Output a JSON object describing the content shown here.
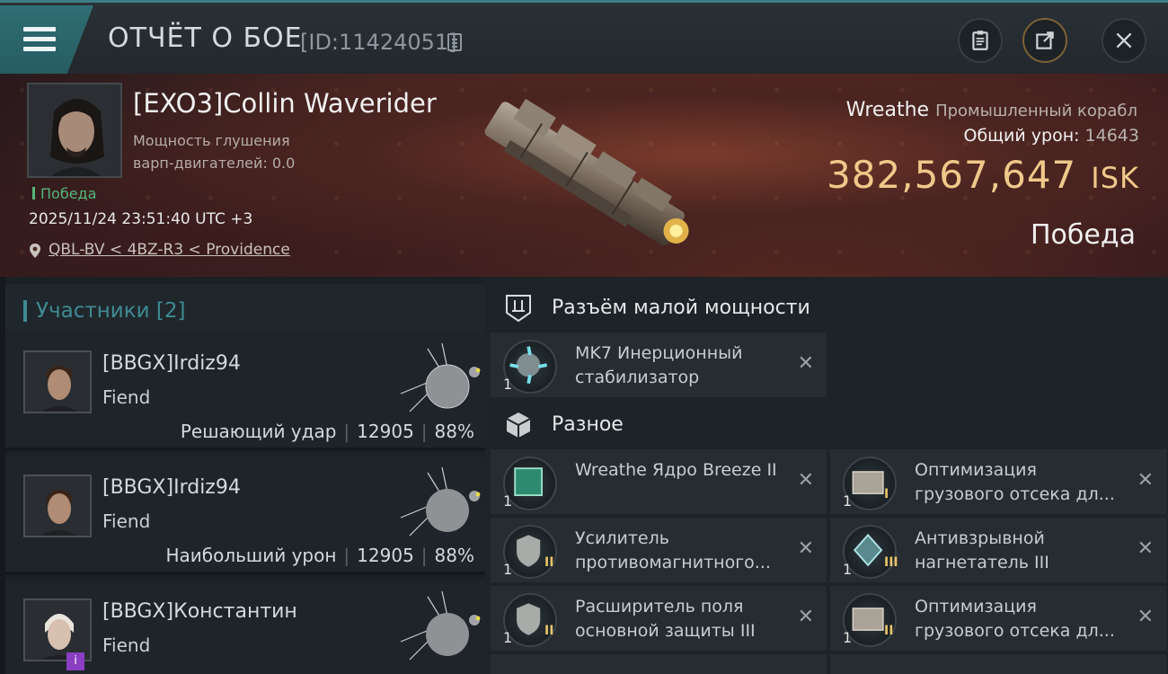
{
  "header": {
    "title": "ОТЧЁТ О БОЕ",
    "report_id": "[ID:11424051]"
  },
  "victor": {
    "name": "[EXO3]Collin Waverider",
    "warp_label_line1": "Мощность глушения",
    "warp_label_line2": "варп-двигателей: 0.0",
    "tag": "Победа",
    "timestamp": "2025/11/24 23:51:40 UTC +3",
    "location": "QBL-BV < 4BZ-R3 < Providence"
  },
  "target": {
    "ship_name": "Wreathe",
    "ship_class": "Промышленный корабл",
    "damage_label": "Общий урон:",
    "damage_value": "14643",
    "isk_value": "382,567,647",
    "isk_currency": "ISK",
    "result": "Победа"
  },
  "participants": {
    "title": "Участники [2]",
    "items": [
      {
        "name": "[BBGX]Irdiz94",
        "ship": "Fiend",
        "role": "Решающий удар",
        "damage": "12905",
        "percent": "88%"
      },
      {
        "name": "[BBGX]Irdiz94",
        "ship": "Fiend",
        "role": "Наибольший урон",
        "damage": "12905",
        "percent": "88%"
      },
      {
        "name": "[BBGX]Константин",
        "ship": "Fiend",
        "role": "",
        "damage": "",
        "percent": ""
      }
    ]
  },
  "sections": {
    "low_slot": "Разъём малой мощности",
    "misc": "Разное"
  },
  "modules": {
    "low": [
      {
        "qty": "1",
        "name": "MK7 Инерционный стабилизатор",
        "tier": ""
      }
    ],
    "misc": [
      {
        "qty": "1",
        "name": "Wreathe Ядро Breeze II",
        "tier": ""
      },
      {
        "qty": "1",
        "name": "Оптимизация грузового отсека дл...",
        "tier": "I"
      },
      {
        "qty": "1",
        "name": "Усилитель противомагнитного...",
        "tier": "II"
      },
      {
        "qty": "1",
        "name": "Антивзрывной нагнетатель III",
        "tier": "III"
      },
      {
        "qty": "1",
        "name": "Расширитель поля основной защиты III",
        "tier": "II"
      },
      {
        "qty": "1",
        "name": "Оптимизация грузового отсека дл...",
        "tier": "II"
      }
    ]
  },
  "icons": {
    "menu": "menu-icon",
    "copy": "copy-icon",
    "clipboard": "clipboard-icon",
    "share": "share-icon",
    "close": "close-icon",
    "location": "location-pin-icon",
    "remove": "close-x-icon"
  },
  "colors": {
    "accent": "#3f8b93",
    "isk": "#f0c98a",
    "victory": "#56b67a"
  }
}
